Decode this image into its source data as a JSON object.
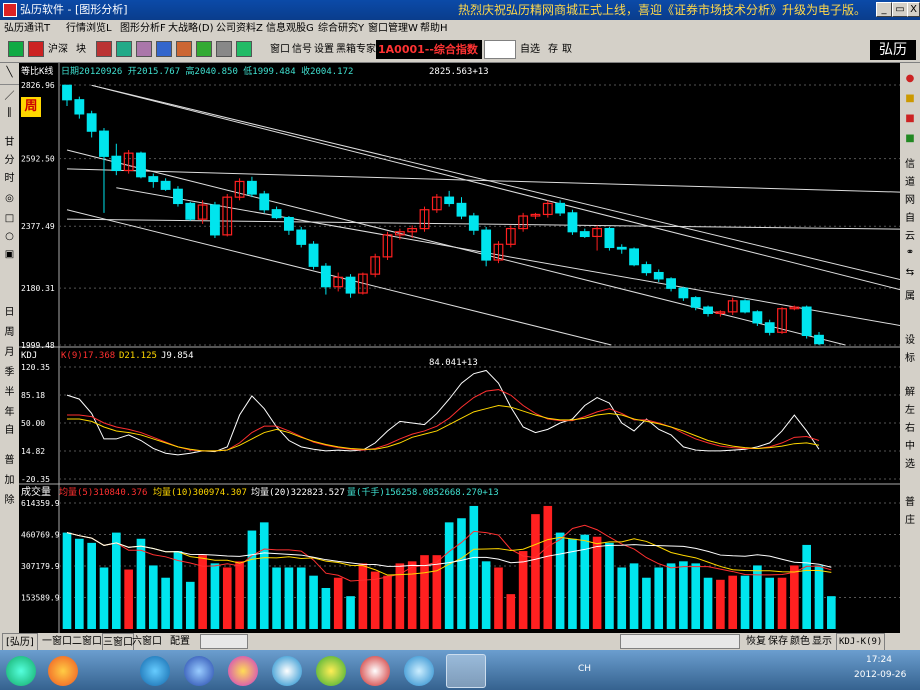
{
  "window": {
    "title": "弘历软件 - [图形分析]",
    "scroll_text": "热烈庆祝弘历精网商城正式上线，喜迎《证券市场技术分析》升级为电子版。",
    "min": "_",
    "restore": "▭",
    "close": "X"
  },
  "menu": [
    "弘历通讯T",
    "行情浏览L",
    "图形分析F",
    "大战略(D)",
    "公司资料Z",
    "信息观股G",
    "综合研究Y",
    "窗口管理W",
    "帮助H"
  ],
  "toolbar": {
    "items": [
      "沪深",
      "块",
      "窗口",
      "信号",
      "设置",
      "黑箱专家"
    ],
    "stock": "1A0001--综合指数",
    "right": [
      "自选",
      "存",
      "取"
    ],
    "logo": "弘历"
  },
  "left_toolbar": [
    "甘",
    "分",
    "时",
    "日",
    "周",
    "月",
    "季",
    "半",
    "年",
    "自",
    "普",
    "加",
    "除"
  ],
  "right_toolbar": [
    "信",
    "道",
    "网",
    "自",
    "云",
    "属",
    "设",
    "标",
    "解",
    "左",
    "右",
    "中",
    "选",
    "普",
    "庄"
  ],
  "main_panel": {
    "title": "等比K线",
    "info": "日期20120926  开2015.767  高2040.850  低1999.484  收2004.172",
    "peak_label": "2825.563+13",
    "period_badge": "周",
    "y_ticks": [
      "2826.96",
      "2592.50",
      "2377.49",
      "2180.31",
      "1999.48"
    ]
  },
  "kdj_panel": {
    "title": "KDJ",
    "k": "K(9)17.368",
    "d": "D21.125",
    "j": "J9.854",
    "peak_label": "84.041+13",
    "y_ticks": [
      "120.35",
      "85.18",
      "50.00",
      "14.82",
      "-20.35"
    ]
  },
  "vol_panel": {
    "title": "成交量",
    "ma5": "均量(5)310840.376",
    "ma10": "均量(10)300974.307",
    "ma20": "均量(20)322823.527",
    "vol": "量(千手)156258.0852668.270+13",
    "y_ticks": [
      "614359.9",
      "460769.9",
      "307179.9",
      "153589.9"
    ]
  },
  "bottom_bar": {
    "tabs": [
      "[弘历]",
      "一窗口",
      "二窗口",
      "三窗口",
      "六窗口",
      "配置"
    ],
    "right": [
      "恢复",
      "保存",
      "颜色",
      "显示"
    ],
    "indicator": "KDJ-K(9)"
  },
  "taskbar": {
    "time": "17:24",
    "date": "2012-09-26",
    "lang": "CH"
  },
  "colors": {
    "up": "#ff2020",
    "down": "#00e5ee",
    "k_line": "#ffffff",
    "d_line": "#ff3030",
    "j_line": "#ffd700",
    "ma_line": "#ffffff"
  },
  "chart_data": {
    "type": "candlestick",
    "price_range": [
      1999.48,
      2826.96
    ],
    "candles": [
      {
        "o": 2826,
        "h": 2827,
        "l": 2760,
        "c": 2780
      },
      {
        "o": 2780,
        "h": 2790,
        "l": 2720,
        "c": 2735
      },
      {
        "o": 2735,
        "h": 2745,
        "l": 2660,
        "c": 2680
      },
      {
        "o": 2680,
        "h": 2690,
        "l": 2420,
        "c": 2600
      },
      {
        "o": 2600,
        "h": 2640,
        "l": 2540,
        "c": 2555
      },
      {
        "o": 2555,
        "h": 2620,
        "l": 2545,
        "c": 2610
      },
      {
        "o": 2610,
        "h": 2615,
        "l": 2530,
        "c": 2535
      },
      {
        "o": 2535,
        "h": 2545,
        "l": 2500,
        "c": 2520
      },
      {
        "o": 2520,
        "h": 2530,
        "l": 2490,
        "c": 2495
      },
      {
        "o": 2495,
        "h": 2505,
        "l": 2440,
        "c": 2450
      },
      {
        "o": 2450,
        "h": 2455,
        "l": 2395,
        "c": 2400
      },
      {
        "o": 2400,
        "h": 2460,
        "l": 2385,
        "c": 2445
      },
      {
        "o": 2445,
        "h": 2455,
        "l": 2340,
        "c": 2350
      },
      {
        "o": 2350,
        "h": 2480,
        "l": 2345,
        "c": 2470
      },
      {
        "o": 2470,
        "h": 2530,
        "l": 2460,
        "c": 2520
      },
      {
        "o": 2520,
        "h": 2535,
        "l": 2470,
        "c": 2480
      },
      {
        "o": 2480,
        "h": 2490,
        "l": 2420,
        "c": 2430
      },
      {
        "o": 2430,
        "h": 2440,
        "l": 2400,
        "c": 2405
      },
      {
        "o": 2405,
        "h": 2410,
        "l": 2350,
        "c": 2365
      },
      {
        "o": 2365,
        "h": 2375,
        "l": 2310,
        "c": 2320
      },
      {
        "o": 2320,
        "h": 2330,
        "l": 2240,
        "c": 2250
      },
      {
        "o": 2250,
        "h": 2260,
        "l": 2160,
        "c": 2185
      },
      {
        "o": 2185,
        "h": 2230,
        "l": 2170,
        "c": 2215
      },
      {
        "o": 2215,
        "h": 2225,
        "l": 2150,
        "c": 2165
      },
      {
        "o": 2165,
        "h": 2230,
        "l": 2160,
        "c": 2225
      },
      {
        "o": 2225,
        "h": 2290,
        "l": 2215,
        "c": 2280
      },
      {
        "o": 2280,
        "h": 2360,
        "l": 2270,
        "c": 2350
      },
      {
        "o": 2350,
        "h": 2370,
        "l": 2335,
        "c": 2360
      },
      {
        "o": 2360,
        "h": 2380,
        "l": 2340,
        "c": 2370
      },
      {
        "o": 2370,
        "h": 2440,
        "l": 2360,
        "c": 2430
      },
      {
        "o": 2430,
        "h": 2480,
        "l": 2420,
        "c": 2470
      },
      {
        "o": 2470,
        "h": 2490,
        "l": 2440,
        "c": 2450
      },
      {
        "o": 2450,
        "h": 2470,
        "l": 2400,
        "c": 2410
      },
      {
        "o": 2410,
        "h": 2420,
        "l": 2350,
        "c": 2365
      },
      {
        "o": 2365,
        "h": 2375,
        "l": 2250,
        "c": 2270
      },
      {
        "o": 2270,
        "h": 2330,
        "l": 2260,
        "c": 2320
      },
      {
        "o": 2320,
        "h": 2380,
        "l": 2310,
        "c": 2370
      },
      {
        "o": 2370,
        "h": 2420,
        "l": 2360,
        "c": 2410
      },
      {
        "o": 2410,
        "h": 2420,
        "l": 2400,
        "c": 2415
      },
      {
        "o": 2415,
        "h": 2460,
        "l": 2405,
        "c": 2450
      },
      {
        "o": 2450,
        "h": 2460,
        "l": 2410,
        "c": 2420
      },
      {
        "o": 2420,
        "h": 2430,
        "l": 2350,
        "c": 2360
      },
      {
        "o": 2360,
        "h": 2370,
        "l": 2340,
        "c": 2345
      },
      {
        "o": 2345,
        "h": 2380,
        "l": 2300,
        "c": 2370
      },
      {
        "o": 2370,
        "h": 2375,
        "l": 2300,
        "c": 2310
      },
      {
        "o": 2310,
        "h": 2320,
        "l": 2290,
        "c": 2305
      },
      {
        "o": 2305,
        "h": 2310,
        "l": 2250,
        "c": 2255
      },
      {
        "o": 2255,
        "h": 2265,
        "l": 2220,
        "c": 2230
      },
      {
        "o": 2230,
        "h": 2240,
        "l": 2200,
        "c": 2210
      },
      {
        "o": 2210,
        "h": 2215,
        "l": 2170,
        "c": 2180
      },
      {
        "o": 2180,
        "h": 2185,
        "l": 2140,
        "c": 2150
      },
      {
        "o": 2150,
        "h": 2155,
        "l": 2110,
        "c": 2120
      },
      {
        "o": 2120,
        "h": 2125,
        "l": 2090,
        "c": 2100
      },
      {
        "o": 2100,
        "h": 2110,
        "l": 2090,
        "c": 2105
      },
      {
        "o": 2105,
        "h": 2150,
        "l": 2095,
        "c": 2140
      },
      {
        "o": 2140,
        "h": 2145,
        "l": 2100,
        "c": 2105
      },
      {
        "o": 2105,
        "h": 2110,
        "l": 2060,
        "c": 2070
      },
      {
        "o": 2070,
        "h": 2080,
        "l": 2030,
        "c": 2040
      },
      {
        "o": 2040,
        "h": 2120,
        "l": 2035,
        "c": 2115
      },
      {
        "o": 2115,
        "h": 2125,
        "l": 2110,
        "c": 2120
      },
      {
        "o": 2120,
        "h": 2125,
        "l": 2020,
        "c": 2030
      },
      {
        "o": 2030,
        "h": 2041,
        "l": 1999,
        "c": 2004
      }
    ],
    "kdj": {
      "range": [
        -20.35,
        120.35
      ],
      "k": [
        85,
        80,
        62,
        30,
        30,
        35,
        28,
        18,
        12,
        10,
        12,
        15,
        14,
        20,
        60,
        84,
        68,
        45,
        28,
        20,
        17,
        15,
        16,
        15,
        16,
        25,
        40,
        52,
        50,
        48,
        62,
        80,
        100,
        112,
        116,
        100,
        70,
        45,
        38,
        42,
        50,
        55,
        72,
        82,
        75,
        50,
        40,
        55,
        42,
        35,
        20,
        16,
        15,
        15,
        16,
        17,
        20,
        25,
        40,
        60,
        40,
        17
      ],
      "d": [
        60,
        60,
        58,
        50,
        45,
        42,
        38,
        32,
        26,
        20,
        16,
        15,
        15,
        16,
        25,
        38,
        46,
        46,
        40,
        33,
        26,
        22,
        19,
        17,
        16,
        18,
        23,
        30,
        36,
        40,
        46,
        56,
        70,
        82,
        90,
        92,
        85,
        72,
        62,
        55,
        53,
        53,
        58,
        64,
        68,
        62,
        54,
        54,
        50,
        45,
        37,
        30,
        25,
        21,
        19,
        18,
        18,
        20,
        25,
        32,
        33,
        28
      ],
      "j": [
        55,
        55,
        52,
        45,
        40,
        38,
        35,
        30,
        25,
        20,
        17,
        15,
        15,
        16,
        22,
        30,
        38,
        42,
        38,
        32,
        27,
        23,
        20,
        18,
        17,
        17,
        20,
        25,
        32,
        36,
        40,
        48,
        56,
        64,
        68,
        72,
        70,
        65,
        60,
        56,
        54,
        54,
        56,
        60,
        62,
        60,
        55,
        52,
        49,
        45,
        40,
        34,
        28,
        24,
        21,
        19,
        18,
        19,
        21,
        24,
        25,
        22
      ]
    },
    "volume": {
      "range": [
        0,
        614359.9
      ],
      "v": [
        470000,
        440000,
        420000,
        300000,
        470000,
        290000,
        440000,
        310000,
        250000,
        380000,
        230000,
        360000,
        320000,
        300000,
        330000,
        480000,
        520000,
        300000,
        300000,
        300000,
        260000,
        200000,
        250000,
        160000,
        320000,
        280000,
        260000,
        320000,
        330000,
        360000,
        360000,
        520000,
        540000,
        600000,
        330000,
        300000,
        170000,
        380000,
        560000,
        600000,
        470000,
        440000,
        460000,
        450000,
        420000,
        300000,
        320000,
        250000,
        300000,
        320000,
        330000,
        320000,
        250000,
        240000,
        260000,
        260000,
        310000,
        250000,
        250000,
        310000,
        410000,
        310000,
        160000
      ]
    }
  }
}
